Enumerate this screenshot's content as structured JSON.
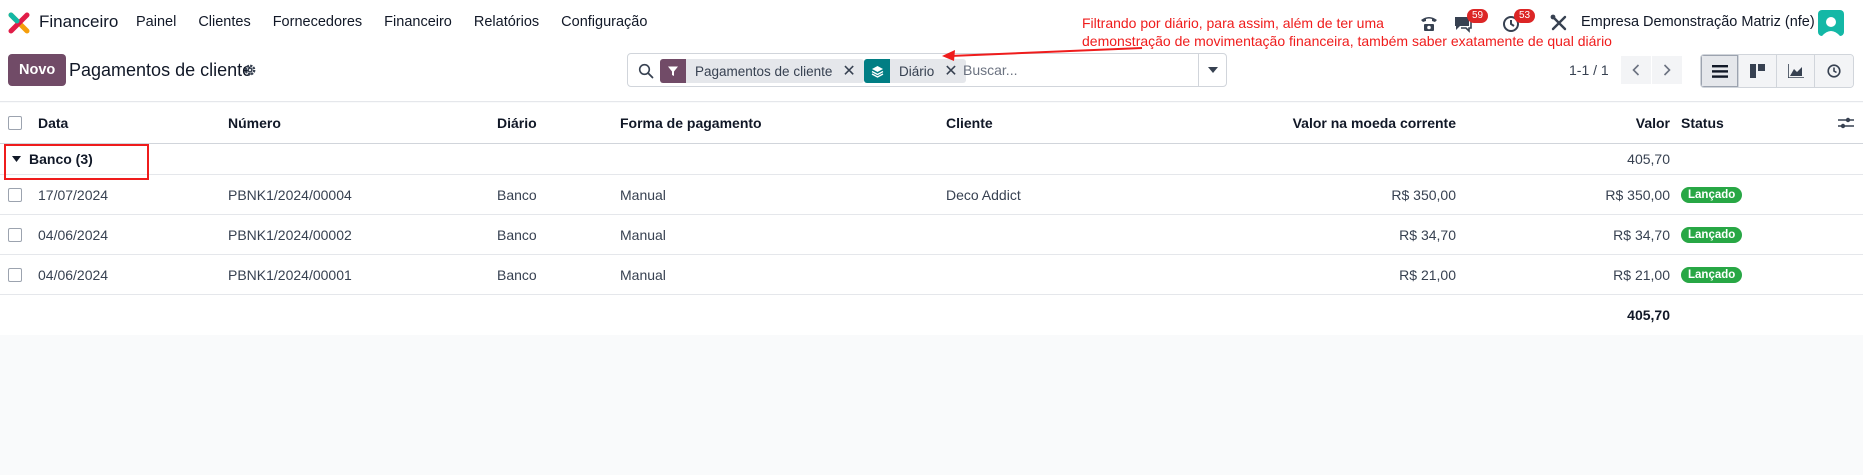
{
  "app": {
    "name": "Financeiro"
  },
  "menu": [
    "Painel",
    "Clientes",
    "Fornecedores",
    "Financeiro",
    "Relatórios",
    "Configuração"
  ],
  "systray": {
    "messages_count": "59",
    "activities_count": "53",
    "company": "Empresa Demonstração Matriz (nfe)"
  },
  "control": {
    "new_label": "Novo",
    "title": "Pagamentos de cliente",
    "pager": "1-1 / 1"
  },
  "search": {
    "facets": [
      {
        "label": "Pagamentos de cliente",
        "icon": "filter-icon"
      },
      {
        "label": "Diário",
        "icon": "layers-icon"
      }
    ],
    "placeholder": "Buscar..."
  },
  "annotation": {
    "line1": "Filtrando por diário, para assim, além de ter uma",
    "line2": "demonstração de movimentação financeira, também saber exatamente de qual diário"
  },
  "table": {
    "columns": [
      "Data",
      "Número",
      "Diário",
      "Forma de pagamento",
      "Cliente",
      "Valor na moeda corrente",
      "Valor",
      "Status"
    ],
    "group": {
      "label": "Banco (3)",
      "total": "405,70"
    },
    "rows": [
      {
        "date": "17/07/2024",
        "number": "PBNK1/2024/00004",
        "journal": "Banco",
        "method": "Manual",
        "customer": "Deco Addict",
        "amount_currency": "R$ 350,00",
        "amount": "R$ 350,00",
        "status": "Lançado"
      },
      {
        "date": "04/06/2024",
        "number": "PBNK1/2024/00002",
        "journal": "Banco",
        "method": "Manual",
        "customer": "",
        "amount_currency": "R$ 34,70",
        "amount": "R$ 34,70",
        "status": "Lançado"
      },
      {
        "date": "04/06/2024",
        "number": "PBNK1/2024/00001",
        "journal": "Banco",
        "method": "Manual",
        "customer": "",
        "amount_currency": "R$ 21,00",
        "amount": "R$ 21,00",
        "status": "Lançado"
      }
    ],
    "grand_total": "405,70"
  },
  "colors": {
    "brand": "#714b67",
    "status_posted": "#28a745",
    "annotation": "#ef1c1c"
  }
}
